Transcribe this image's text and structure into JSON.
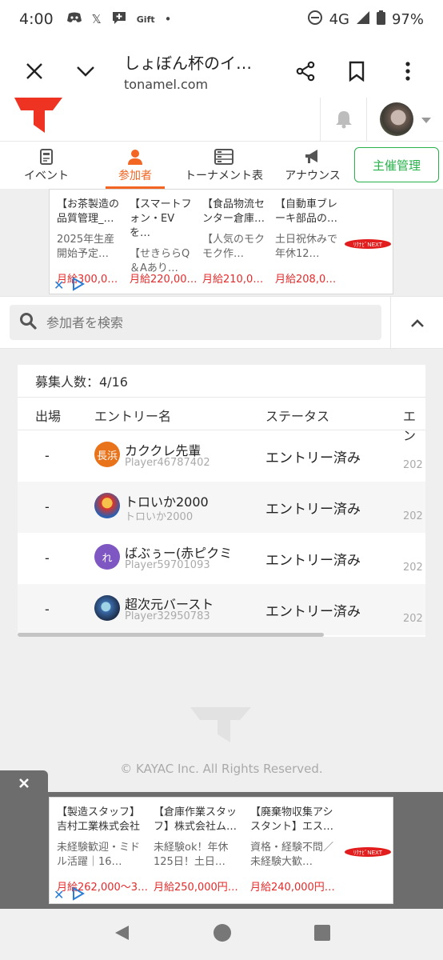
{
  "status": {
    "time": "4:00",
    "gift": "Gift",
    "network": "4G",
    "battery": "97%"
  },
  "browser": {
    "title": "しょぼん杯のイ…",
    "url": "tonamel.com"
  },
  "tabs": [
    {
      "label": "イベント",
      "icon": "event-icon"
    },
    {
      "label": "参加者",
      "icon": "person-icon",
      "active": true
    },
    {
      "label": "トーナメント表",
      "icon": "bracket-icon"
    },
    {
      "label": "アナウンス",
      "icon": "megaphone-icon"
    }
  ],
  "organizer_button": "主催管理",
  "ad_top": [
    {
      "heading": "【お茶製造の品質管理_…",
      "body": "2025年生産開始予定…",
      "price": "月給300,0…"
    },
    {
      "heading": "【スマートフォン・EVを…",
      "body": "【せきららQ＆Aあり…",
      "price": "月給220,00…"
    },
    {
      "heading": "【食品物流センター倉庫…",
      "body": "【人気のモクモク作…",
      "price": "月給210,0…"
    },
    {
      "heading": "【自動車ブレーキ部品の…",
      "body": "土日祝休みで年休12…",
      "price": "月給208,0…"
    }
  ],
  "search": {
    "placeholder": "参加者を検索"
  },
  "table": {
    "count": "募集人数：4/16",
    "headers": [
      "出場",
      "エントリー名",
      "ステータス",
      "エン"
    ],
    "rows": [
      {
        "attend": "-",
        "name": "カククレ先輩",
        "player": "Player46787402",
        "status": "エントリー済み",
        "avatar_text": "長浜",
        "avatar_color": "#e8731a",
        "date": "202"
      },
      {
        "attend": "-",
        "name": "トロいか2000",
        "player": "トロいか2000",
        "status": "エントリー済み",
        "avatar_text": "",
        "avatar_color": "#d8342c",
        "date": "202"
      },
      {
        "attend": "-",
        "name": "ばぶぅー(赤ピクミ",
        "player": "Player59701093",
        "status": "エントリー済み",
        "avatar_text": "れ",
        "avatar_color": "#7e57c2",
        "date": "202"
      },
      {
        "attend": "-",
        "name": "超次元バースト",
        "player": "Player32950783",
        "status": "エントリー済み",
        "avatar_text": "",
        "avatar_color": "#3a6aa8",
        "date": "202"
      }
    ]
  },
  "footer": {
    "copyright": "© KAYAC Inc. All Rights Reserved."
  },
  "ad_bottom": [
    {
      "heading": "【製造スタッフ】吉村工業株式会社",
      "body": "未経験歓迎・ミドル活躍｜16…",
      "price": "月給262,000～3…"
    },
    {
      "heading": "【倉庫作業スタッフ】株式会社ム…",
      "body": "未経験ok！年休125日！土日…",
      "price": "月給250,000円…"
    },
    {
      "heading": "【廃棄物収集アシスタント】エス…",
      "body": "資格・経験不問／未経験大歓…",
      "price": "月給240,000円…"
    }
  ],
  "ad_logo_text": "ﾘｸﾅﾋﾞNEXT"
}
